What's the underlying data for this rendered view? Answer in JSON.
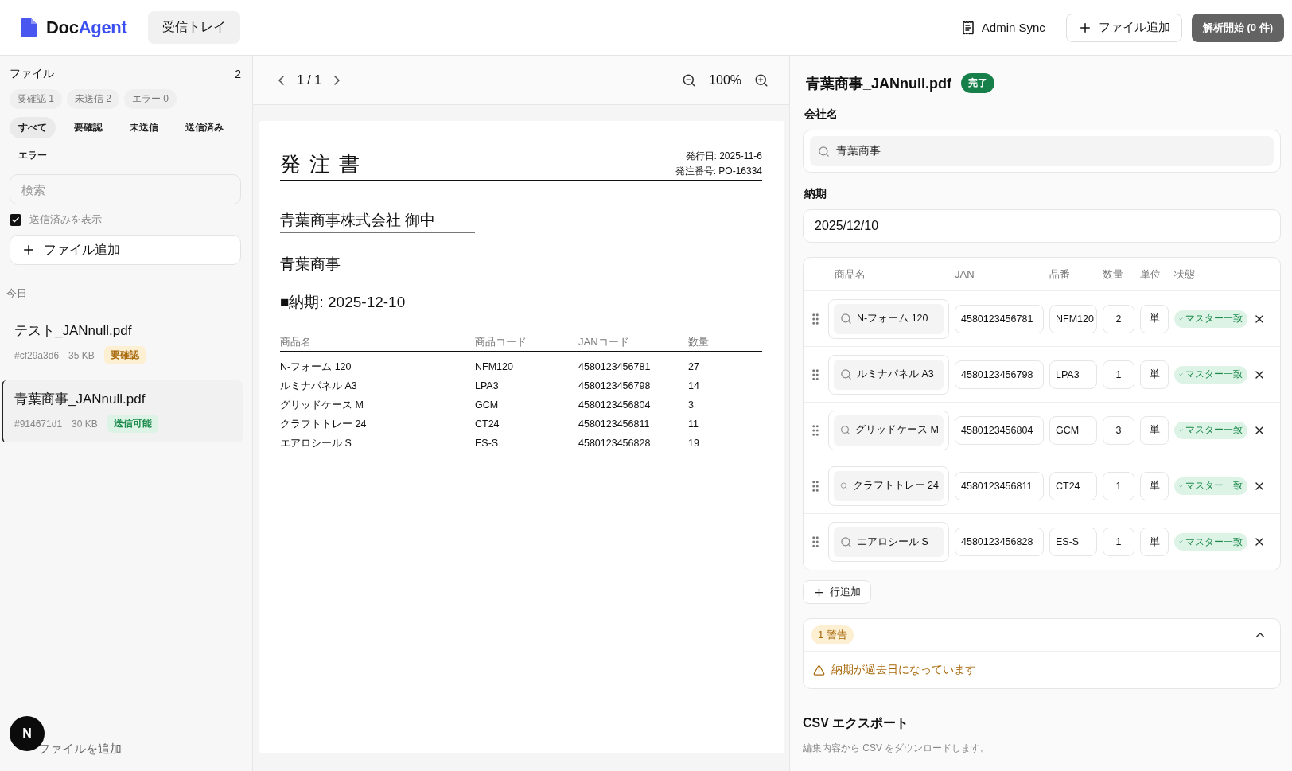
{
  "header": {
    "logo": {
      "main": "Doc",
      "accent": "Agent"
    },
    "nav_tabs": [
      {
        "label": "受信トレイ",
        "selected": true
      }
    ],
    "actions": [
      {
        "kind": "link",
        "label": "Admin Sync",
        "disabled": false
      },
      {
        "kind": "outline",
        "label": "ファイル追加",
        "disabled": false
      },
      {
        "kind": "primary",
        "label": "解析開始 (0 件)",
        "disabled": true
      }
    ]
  },
  "sidebar": {
    "title": "ファイル",
    "count": "2",
    "stat_chips": [
      "要確認 1",
      "未送信 2",
      "エラー 0"
    ],
    "filters": [
      {
        "label": "すべて",
        "selected": true
      },
      {
        "label": "要確認",
        "selected": false
      },
      {
        "label": "未送信",
        "selected": false
      },
      {
        "label": "送信済み",
        "selected": false
      },
      {
        "label": "エラー",
        "selected": false
      }
    ],
    "search": {
      "placeholder": "検索"
    },
    "show_sent": {
      "label": "送信済みを表示",
      "checked": true
    },
    "add_button": "ファイル追加",
    "group_label": "今日",
    "files": [
      {
        "name": "テスト_JANnull.pdf",
        "hash": "#cf29a3d6",
        "size": "35 KB",
        "status": "要確認",
        "kind": "warning",
        "selected": false
      },
      {
        "name": "青葉商事_JANnull.pdf",
        "hash": "#914671d1",
        "size": "30 KB",
        "status": "送信可能",
        "kind": "success",
        "selected": true
      }
    ],
    "footer": {
      "avatar": "N",
      "label": "ファイルを追加"
    }
  },
  "viewer": {
    "page": "1 / 1",
    "zoom": "100%",
    "document": {
      "title": "発 注 書",
      "issue_date": "発行日: 2025-11-6",
      "order_no": "発注番号: PO-16334",
      "addressee": "青葉商事株式会社 御中",
      "sender": "青葉商事",
      "delivery": "■納期: 2025-12-10",
      "columns": [
        "商品名",
        "商品コード",
        "JANコード",
        "数量"
      ],
      "rows": [
        [
          "N-フォーム 120",
          "NFM120",
          "4580123456781",
          "27"
        ],
        [
          "ルミナパネル A3",
          "LPA3",
          "4580123456798",
          "14"
        ],
        [
          "グリッドケース M",
          "GCM",
          "4580123456804",
          "3"
        ],
        [
          "クラフトトレー 24",
          "CT24",
          "4580123456811",
          "11"
        ],
        [
          "エアロシール S",
          "ES-S",
          "4580123456828",
          "19"
        ]
      ]
    }
  },
  "detail": {
    "filename": "青葉商事_JANnull.pdf",
    "status": "完了",
    "company_label": "会社名",
    "company_value": "青葉商事",
    "due_label": "納期",
    "due_value": "2025/12/10",
    "items": {
      "columns": [
        "商品名",
        "JAN",
        "品番",
        "数量",
        "単位",
        "状態"
      ],
      "rows": [
        {
          "name": "N-フォーム 120",
          "jan": "4580123456781",
          "code": "NFM120",
          "qty": "2",
          "unit": "単",
          "status": "マスター一致"
        },
        {
          "name": "ルミナパネル A3",
          "jan": "4580123456798",
          "code": "LPA3",
          "qty": "1",
          "unit": "単",
          "status": "マスター一致"
        },
        {
          "name": "グリッドケース M",
          "jan": "4580123456804",
          "code": "GCM",
          "qty": "3",
          "unit": "単",
          "status": "マスター一致"
        },
        {
          "name": "クラフトトレー 24",
          "jan": "4580123456811",
          "code": "CT24",
          "qty": "1",
          "unit": "単",
          "status": "マスター一致"
        },
        {
          "name": "エアロシール S",
          "jan": "4580123456828",
          "code": "ES-S",
          "qty": "1",
          "unit": "単",
          "status": "マスター一致"
        }
      ]
    },
    "add_row": "行追加",
    "warnings": {
      "badge": "1 警告",
      "expanded": true,
      "messages": [
        "納期が過去日になっています"
      ]
    },
    "export": {
      "title": "CSV エクスポート",
      "description": "編集内容から CSV をダウンロードします。"
    }
  }
}
